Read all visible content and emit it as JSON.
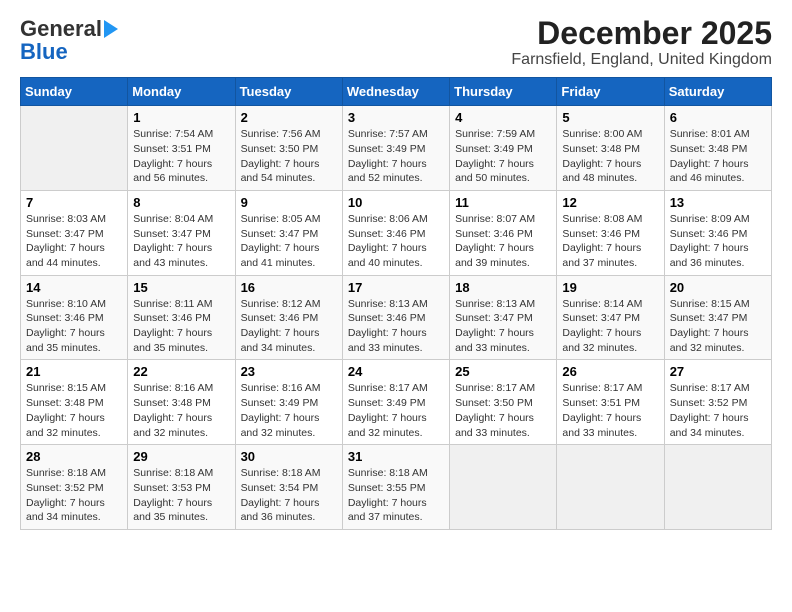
{
  "logo": {
    "line1": "General",
    "line2": "Blue"
  },
  "title": "December 2025",
  "subtitle": "Farnsfield, England, United Kingdom",
  "weekdays": [
    "Sunday",
    "Monday",
    "Tuesday",
    "Wednesday",
    "Thursday",
    "Friday",
    "Saturday"
  ],
  "weeks": [
    [
      {
        "day": "",
        "info": ""
      },
      {
        "day": "1",
        "info": "Sunrise: 7:54 AM\nSunset: 3:51 PM\nDaylight: 7 hours\nand 56 minutes."
      },
      {
        "day": "2",
        "info": "Sunrise: 7:56 AM\nSunset: 3:50 PM\nDaylight: 7 hours\nand 54 minutes."
      },
      {
        "day": "3",
        "info": "Sunrise: 7:57 AM\nSunset: 3:49 PM\nDaylight: 7 hours\nand 52 minutes."
      },
      {
        "day": "4",
        "info": "Sunrise: 7:59 AM\nSunset: 3:49 PM\nDaylight: 7 hours\nand 50 minutes."
      },
      {
        "day": "5",
        "info": "Sunrise: 8:00 AM\nSunset: 3:48 PM\nDaylight: 7 hours\nand 48 minutes."
      },
      {
        "day": "6",
        "info": "Sunrise: 8:01 AM\nSunset: 3:48 PM\nDaylight: 7 hours\nand 46 minutes."
      }
    ],
    [
      {
        "day": "7",
        "info": "Sunrise: 8:03 AM\nSunset: 3:47 PM\nDaylight: 7 hours\nand 44 minutes."
      },
      {
        "day": "8",
        "info": "Sunrise: 8:04 AM\nSunset: 3:47 PM\nDaylight: 7 hours\nand 43 minutes."
      },
      {
        "day": "9",
        "info": "Sunrise: 8:05 AM\nSunset: 3:47 PM\nDaylight: 7 hours\nand 41 minutes."
      },
      {
        "day": "10",
        "info": "Sunrise: 8:06 AM\nSunset: 3:46 PM\nDaylight: 7 hours\nand 40 minutes."
      },
      {
        "day": "11",
        "info": "Sunrise: 8:07 AM\nSunset: 3:46 PM\nDaylight: 7 hours\nand 39 minutes."
      },
      {
        "day": "12",
        "info": "Sunrise: 8:08 AM\nSunset: 3:46 PM\nDaylight: 7 hours\nand 37 minutes."
      },
      {
        "day": "13",
        "info": "Sunrise: 8:09 AM\nSunset: 3:46 PM\nDaylight: 7 hours\nand 36 minutes."
      }
    ],
    [
      {
        "day": "14",
        "info": "Sunrise: 8:10 AM\nSunset: 3:46 PM\nDaylight: 7 hours\nand 35 minutes."
      },
      {
        "day": "15",
        "info": "Sunrise: 8:11 AM\nSunset: 3:46 PM\nDaylight: 7 hours\nand 35 minutes."
      },
      {
        "day": "16",
        "info": "Sunrise: 8:12 AM\nSunset: 3:46 PM\nDaylight: 7 hours\nand 34 minutes."
      },
      {
        "day": "17",
        "info": "Sunrise: 8:13 AM\nSunset: 3:46 PM\nDaylight: 7 hours\nand 33 minutes."
      },
      {
        "day": "18",
        "info": "Sunrise: 8:13 AM\nSunset: 3:47 PM\nDaylight: 7 hours\nand 33 minutes."
      },
      {
        "day": "19",
        "info": "Sunrise: 8:14 AM\nSunset: 3:47 PM\nDaylight: 7 hours\nand 32 minutes."
      },
      {
        "day": "20",
        "info": "Sunrise: 8:15 AM\nSunset: 3:47 PM\nDaylight: 7 hours\nand 32 minutes."
      }
    ],
    [
      {
        "day": "21",
        "info": "Sunrise: 8:15 AM\nSunset: 3:48 PM\nDaylight: 7 hours\nand 32 minutes."
      },
      {
        "day": "22",
        "info": "Sunrise: 8:16 AM\nSunset: 3:48 PM\nDaylight: 7 hours\nand 32 minutes."
      },
      {
        "day": "23",
        "info": "Sunrise: 8:16 AM\nSunset: 3:49 PM\nDaylight: 7 hours\nand 32 minutes."
      },
      {
        "day": "24",
        "info": "Sunrise: 8:17 AM\nSunset: 3:49 PM\nDaylight: 7 hours\nand 32 minutes."
      },
      {
        "day": "25",
        "info": "Sunrise: 8:17 AM\nSunset: 3:50 PM\nDaylight: 7 hours\nand 33 minutes."
      },
      {
        "day": "26",
        "info": "Sunrise: 8:17 AM\nSunset: 3:51 PM\nDaylight: 7 hours\nand 33 minutes."
      },
      {
        "day": "27",
        "info": "Sunrise: 8:17 AM\nSunset: 3:52 PM\nDaylight: 7 hours\nand 34 minutes."
      }
    ],
    [
      {
        "day": "28",
        "info": "Sunrise: 8:18 AM\nSunset: 3:52 PM\nDaylight: 7 hours\nand 34 minutes."
      },
      {
        "day": "29",
        "info": "Sunrise: 8:18 AM\nSunset: 3:53 PM\nDaylight: 7 hours\nand 35 minutes."
      },
      {
        "day": "30",
        "info": "Sunrise: 8:18 AM\nSunset: 3:54 PM\nDaylight: 7 hours\nand 36 minutes."
      },
      {
        "day": "31",
        "info": "Sunrise: 8:18 AM\nSunset: 3:55 PM\nDaylight: 7 hours\nand 37 minutes."
      },
      {
        "day": "",
        "info": ""
      },
      {
        "day": "",
        "info": ""
      },
      {
        "day": "",
        "info": ""
      }
    ]
  ]
}
